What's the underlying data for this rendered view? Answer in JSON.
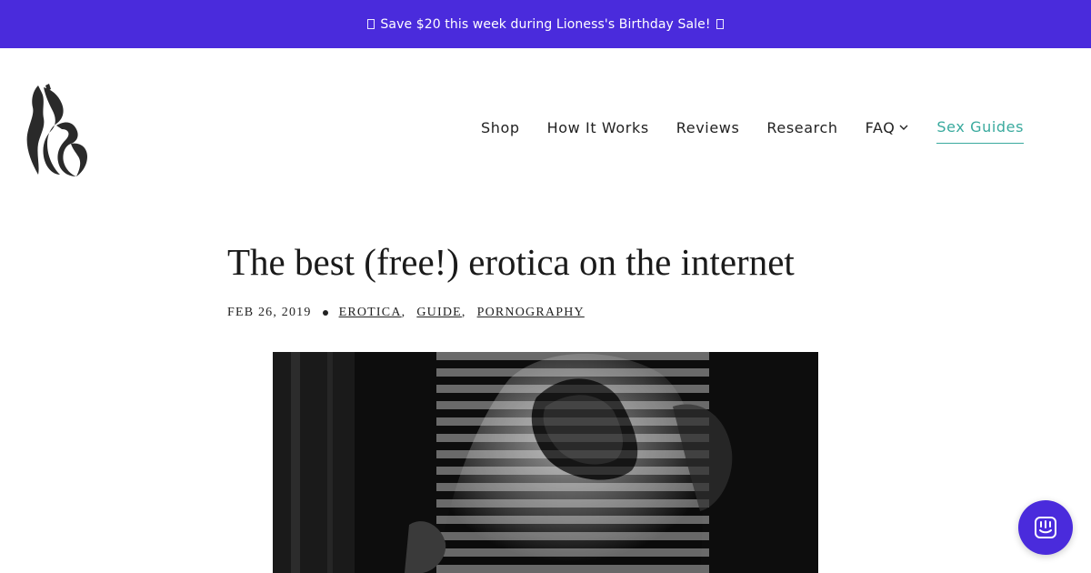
{
  "promo": {
    "text": "Save $20 this week during Lioness's Birthday Sale!",
    "background": "#4a2bdc"
  },
  "logo": {
    "icon": "lioness-logo-icon"
  },
  "nav": {
    "items": [
      {
        "label": "Shop"
      },
      {
        "label": "How It Works"
      },
      {
        "label": "Reviews"
      },
      {
        "label": "Research"
      },
      {
        "label": "FAQ"
      },
      {
        "label": "Sex Guides"
      }
    ],
    "active_color": "#3aaa9e"
  },
  "article": {
    "title": "The best (free!) erotica on the internet",
    "date": "FEB 26, 2019",
    "tags": [
      "EROTICA",
      "GUIDE",
      "PORNOGRAPHY"
    ]
  },
  "hero_image": {
    "description_icon": "hero-photo"
  },
  "chat": {
    "icon": "chat-icon",
    "color": "#4a2bdc"
  }
}
